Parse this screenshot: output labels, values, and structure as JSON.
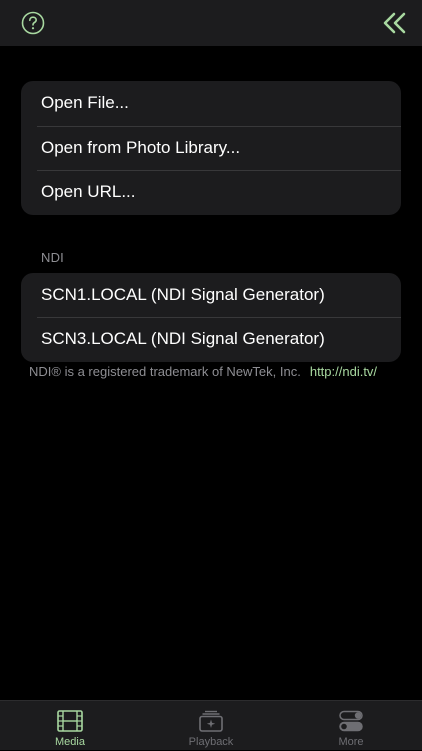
{
  "colors": {
    "accent": "#a8d8a0",
    "background": "#000000",
    "cell_background": "#1c1c1e",
    "secondary_text": "#8e8e93",
    "inactive_tab": "#6e6e73"
  },
  "topbar": {
    "left_icon": "help-circle-icon",
    "right_icon": "double-chevron-left-icon"
  },
  "menu": {
    "items": [
      {
        "label": "Open File..."
      },
      {
        "label": "Open from Photo Library..."
      },
      {
        "label": "Open URL..."
      }
    ]
  },
  "ndi": {
    "header": "NDI",
    "sources": [
      {
        "label": "SCN1.LOCAL (NDI Signal Generator)"
      },
      {
        "label": "SCN3.LOCAL (NDI Signal Generator)"
      }
    ],
    "trademark": "NDI® is a registered trademark of NewTek, Inc.",
    "link": "http://ndi.tv/"
  },
  "tabbar": {
    "tabs": [
      {
        "label": "Media",
        "icon": "film-icon",
        "selected": true
      },
      {
        "label": "Playback",
        "icon": "playback-icon",
        "selected": false
      },
      {
        "label": "More",
        "icon": "toggles-icon",
        "selected": false
      }
    ]
  }
}
